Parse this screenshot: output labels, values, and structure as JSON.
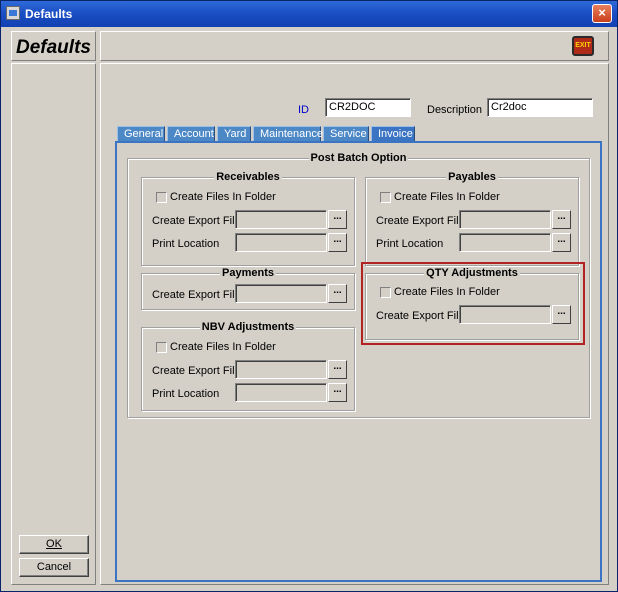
{
  "window": {
    "title": "Defaults",
    "close_label": "×"
  },
  "header": {
    "page_title": "Defaults",
    "exit_label": "EXIT"
  },
  "form": {
    "id_label": "ID",
    "id_value": "CR2DOC",
    "description_label": "Description",
    "description_value": "Cr2doc"
  },
  "tabs": [
    {
      "label": "General",
      "active": false
    },
    {
      "label": "Account",
      "active": false
    },
    {
      "label": "Yard",
      "active": false
    },
    {
      "label": "Maintenance",
      "active": false
    },
    {
      "label": "Service",
      "active": false
    },
    {
      "label": "Invoice",
      "active": true
    }
  ],
  "post_batch": {
    "title": "Post Batch Option",
    "receivables": {
      "title": "Receivables",
      "create_files_label": "Create Files In Folder",
      "export_label": "Create Export File",
      "print_label": "Print Location",
      "browse_label": "..."
    },
    "payables": {
      "title": "Payables",
      "create_files_label": "Create Files In Folder",
      "export_label": "Create Export File",
      "print_label": "Print Location",
      "browse_label": "..."
    },
    "payments": {
      "title": "Payments",
      "export_label": "Create Export File",
      "browse_label": "..."
    },
    "qty_adjustments": {
      "title": "QTY Adjustments",
      "create_files_label": "Create Files In Folder",
      "export_label": "Create Export File",
      "browse_label": "..."
    },
    "nbv_adjustments": {
      "title": "NBV Adjustments",
      "create_files_label": "Create Files In Folder",
      "export_label": "Create Export File",
      "print_label": "Print Location",
      "browse_label": "..."
    }
  },
  "buttons": {
    "ok_label": "OK",
    "cancel_label": "Cancel"
  },
  "colors": {
    "tab_blue": "#3b74c2",
    "highlight_red": "#b22222",
    "id_label_blue": "#0000cc"
  }
}
